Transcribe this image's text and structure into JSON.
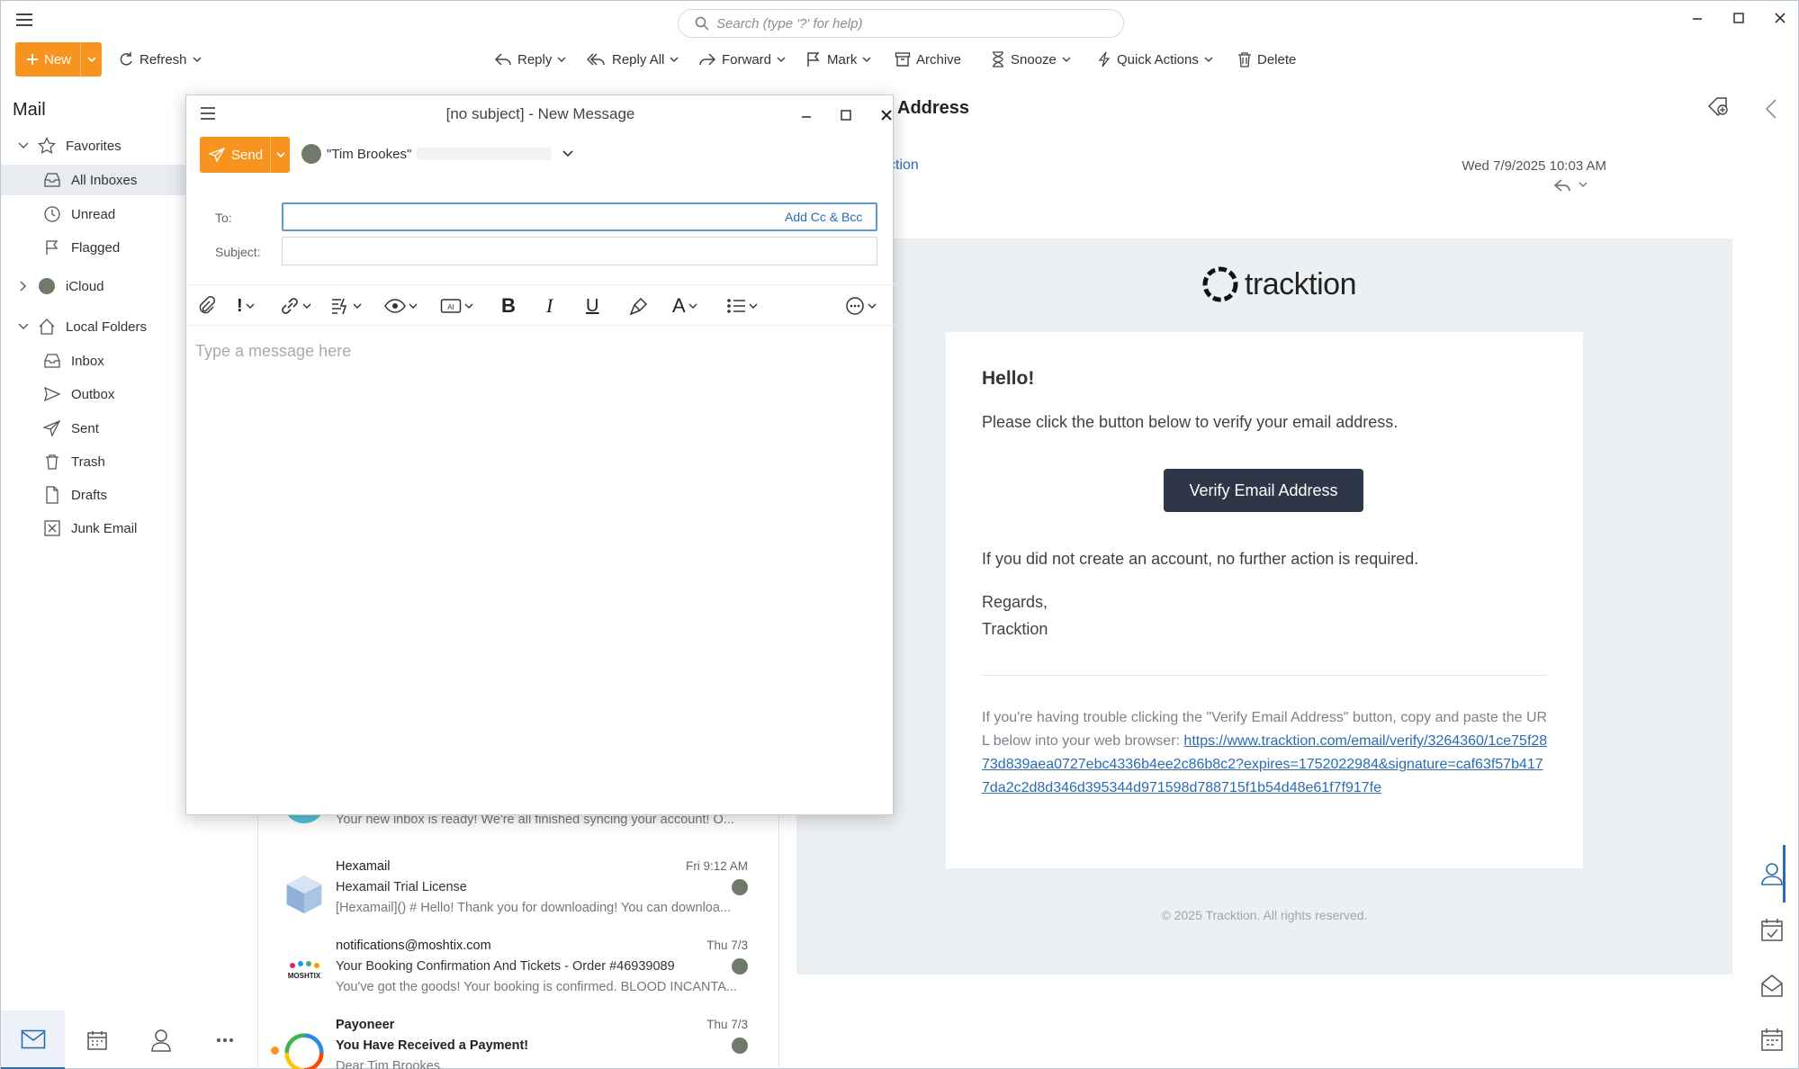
{
  "app": {
    "search_placeholder": "Search (type '?' for help)"
  },
  "toolbar": {
    "new": "New",
    "refresh": "Refresh",
    "reply": "Reply",
    "reply_all": "Reply All",
    "forward": "Forward",
    "mark": "Mark",
    "archive": "Archive",
    "snooze": "Snooze",
    "quick_actions": "Quick Actions",
    "delete": "Delete"
  },
  "sidebar": {
    "title": "Mail",
    "favorites": "Favorites",
    "all_inboxes": "All Inboxes",
    "unread": "Unread",
    "flagged": "Flagged",
    "icloud": "iCloud",
    "local_folders": "Local Folders",
    "inbox": "Inbox",
    "outbox": "Outbox",
    "sent": "Sent",
    "trash": "Trash",
    "drafts": "Drafts",
    "junk": "Junk Email"
  },
  "messages": [
    {
      "from": "",
      "date": "",
      "subject": "",
      "preview": "Your new inbox is ready! We're all finished syncing your account! O..."
    },
    {
      "from": "Hexamail",
      "date": "Fri 9:12 AM",
      "subject": "Hexamail Trial License",
      "preview": "[Hexamail]() # Hello! Thank you for downloading! You can downloa..."
    },
    {
      "from": "notifications@moshtix.com",
      "date": "Thu 7/3",
      "subject": "Your Booking Confirmation And Tickets - Order #46939089",
      "preview": "You've got the goods! Your booking is confirmed. BLOOD INCANTA..."
    },
    {
      "from": "Payoneer",
      "date": "Thu 7/3",
      "subject": "You Have Received a Payment!",
      "preview": "Dear Tim Brookes"
    }
  ],
  "reading": {
    "title_partial": "Address",
    "sender_partial": "ction",
    "date": "Wed 7/9/2025 10:03 AM",
    "logo_text": "tracktion",
    "hello": "Hello!",
    "line1": "Please click the button below to verify your email address.",
    "button": "Verify Email Address",
    "line2": "If you did not create an account, no further action is required.",
    "regards": "Regards,",
    "signoff": "Tracktion",
    "trouble_text": "If you're having trouble clicking the \"Verify Email Address\" button, copy and paste the URL below into your web browser:",
    "url": "https://www.tracktion.com/email/verify/3264360/1ce75f2873d839aea0727ebc4336b4ee2c86b8c2?expires=1752022984&signature=caf63f57b4177da2c2d8d346d395344d971598d788715f1b54d48e61f7f917fe",
    "copyright": "© 2025 Tracktion. All rights reserved."
  },
  "compose": {
    "title": "[no subject] - New Message",
    "send": "Send",
    "from_name": "\"Tim Brookes\"",
    "to_label": "To:",
    "to_value": "",
    "add_cc_bcc": "Add Cc & Bcc",
    "subject_label": "Subject:",
    "subject_value": "",
    "body_placeholder": "Type a message here"
  },
  "colors": {
    "accent_orange": "#f7931e",
    "link_blue": "#2b6cb0",
    "button_dark": "#2d3748"
  }
}
